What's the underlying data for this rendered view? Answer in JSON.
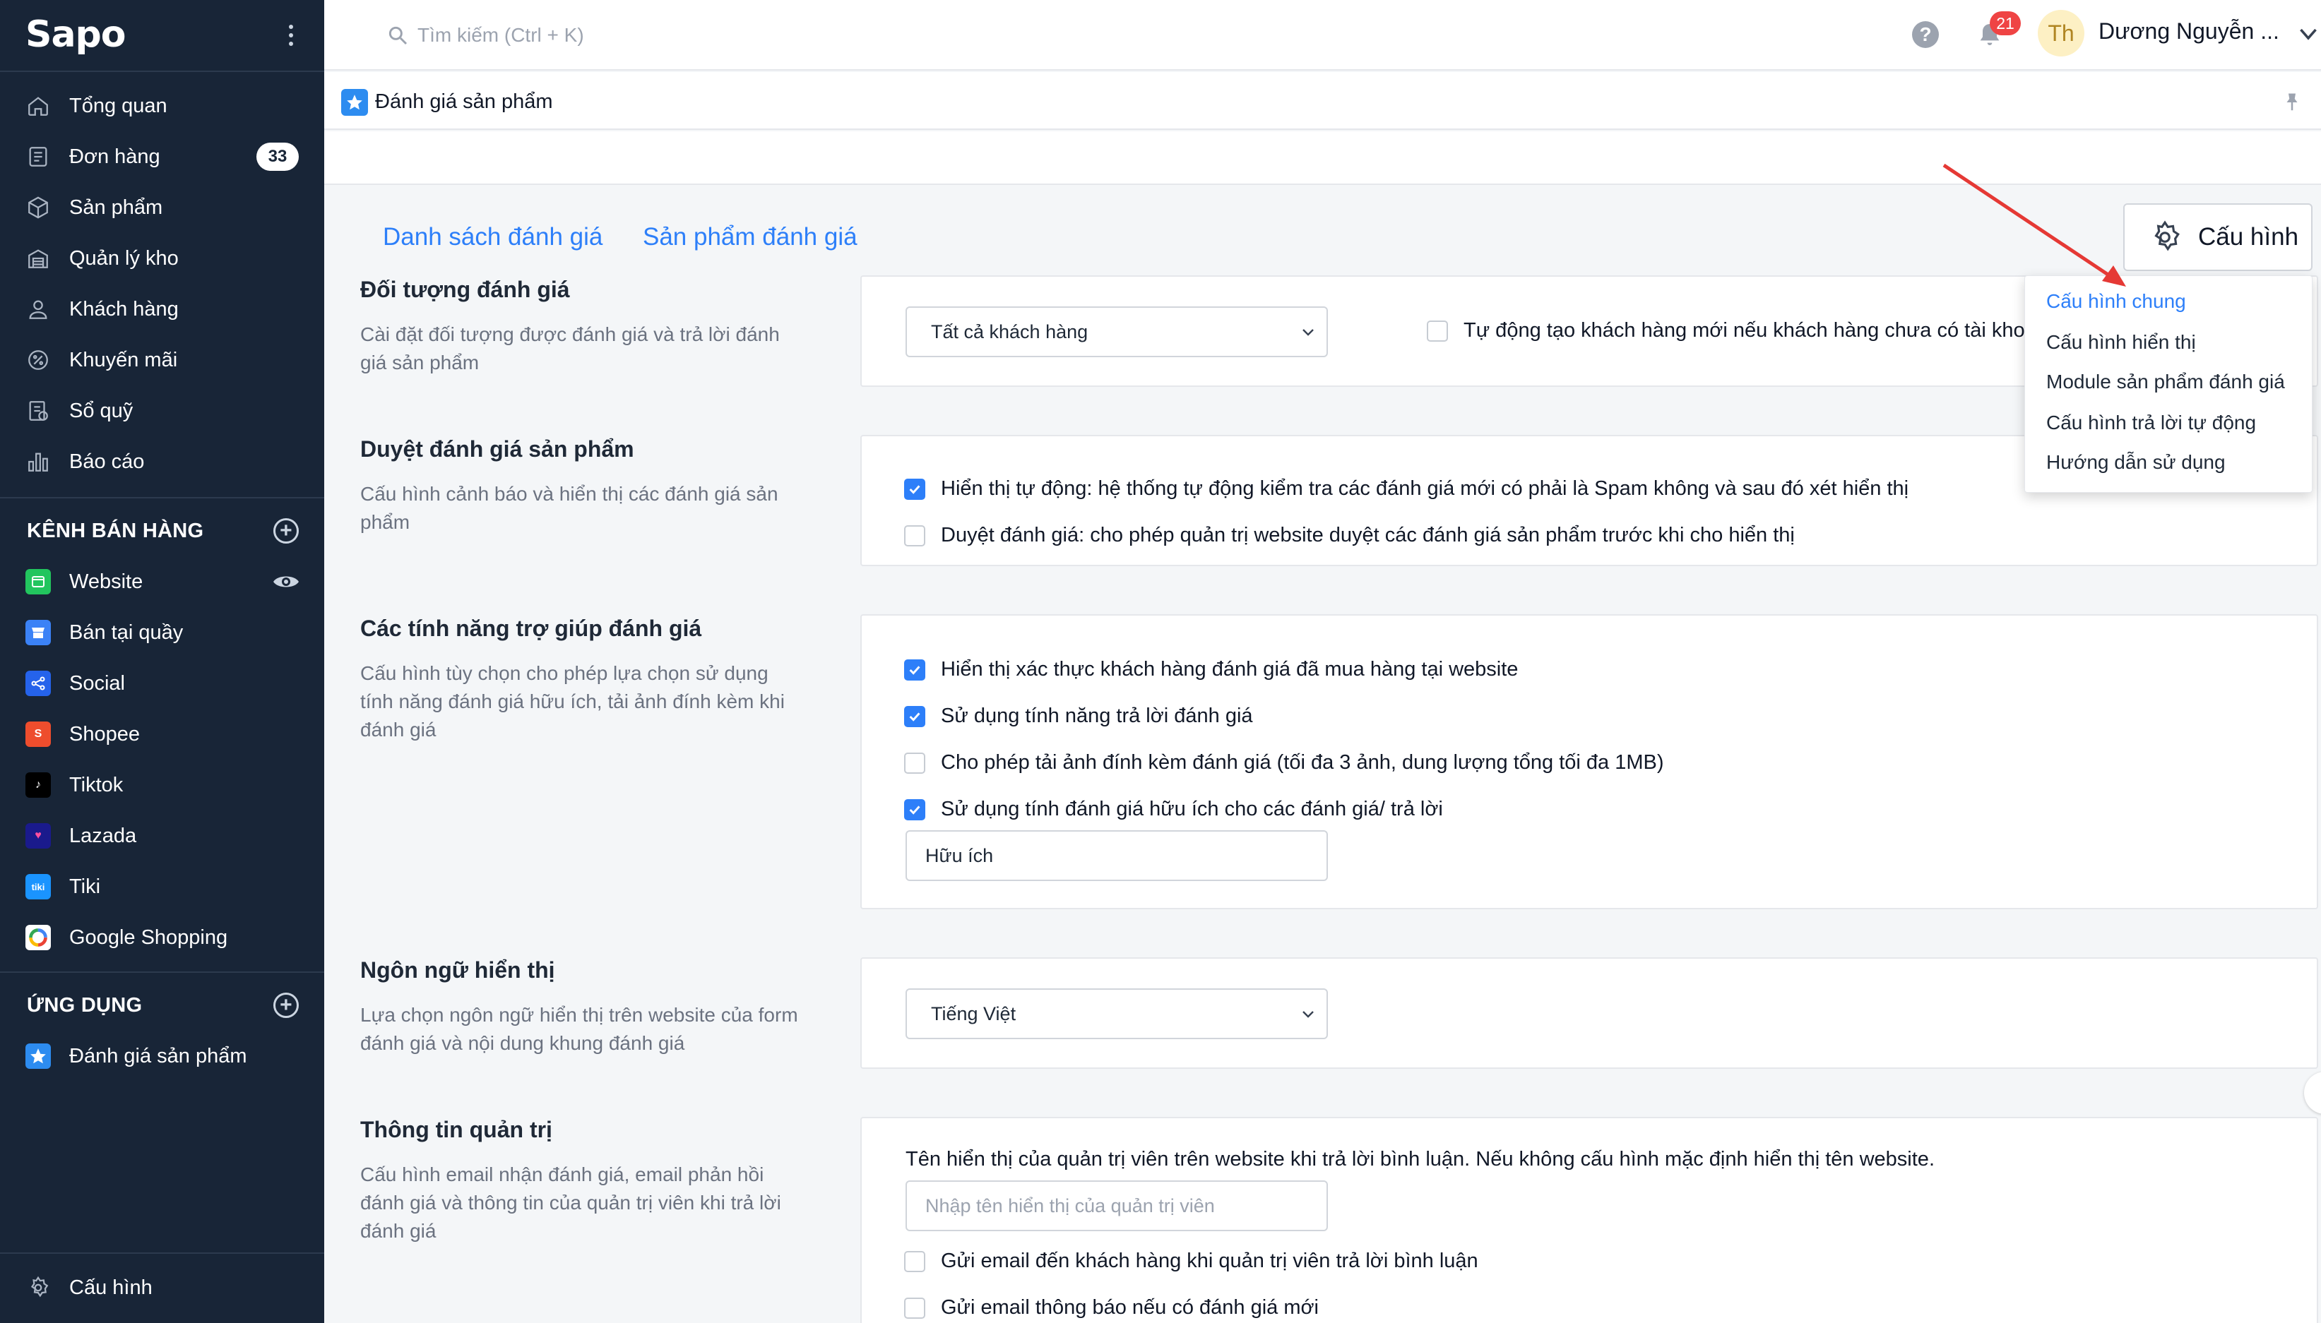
{
  "sidebar": {
    "logo": "Sapo",
    "nav": [
      {
        "label": "Tổng quan",
        "icon": "home-icon"
      },
      {
        "label": "Đơn hàng",
        "icon": "orders-icon",
        "badge": "33"
      },
      {
        "label": "Sản phẩm",
        "icon": "box-icon"
      },
      {
        "label": "Quản lý kho",
        "icon": "warehouse-icon"
      },
      {
        "label": "Khách hàng",
        "icon": "user-icon"
      },
      {
        "label": "Khuyến mãi",
        "icon": "discount-icon"
      },
      {
        "label": "Sổ quỹ",
        "icon": "cashbook-icon"
      },
      {
        "label": "Báo cáo",
        "icon": "report-icon"
      }
    ],
    "sales_channels_title": "KÊNH BÁN HÀNG",
    "channels": [
      {
        "label": "Website",
        "icon": "website-icon",
        "color": "#22c55e"
      },
      {
        "label": "Bán tại quầy",
        "icon": "pos-icon",
        "color": "#3b82f6"
      },
      {
        "label": "Social",
        "icon": "social-icon",
        "color": "#2563eb"
      },
      {
        "label": "Shopee",
        "icon": "shopee-icon",
        "color": "#ee4d2d"
      },
      {
        "label": "Tiktok",
        "icon": "tiktok-icon",
        "color": "#000000"
      },
      {
        "label": "Lazada",
        "icon": "lazada-icon",
        "color": "#1a1a8c"
      },
      {
        "label": "Tiki",
        "icon": "tiki-icon",
        "color": "#1a94ff"
      },
      {
        "label": "Google Shopping",
        "icon": "google-shopping-icon",
        "color": "#ffffff"
      }
    ],
    "apps_title": "ỨNG DỤNG",
    "apps": [
      {
        "label": "Đánh giá sản phẩm",
        "icon": "star-icon"
      }
    ],
    "settings_label": "Cấu hình"
  },
  "topbar": {
    "search_placeholder": "Tìm kiếm (Ctrl + K)",
    "notifications_count": "21",
    "avatar_initials": "Th",
    "user_name": "Dương Nguyễn ..."
  },
  "app_header": {
    "title": "Đánh giá sản phẩm"
  },
  "tabs": [
    {
      "label": "Danh sách đánh giá"
    },
    {
      "label": "Sản phẩm đánh giá"
    }
  ],
  "config_button": {
    "label": "Cấu hình"
  },
  "config_menu": [
    {
      "label": "Cấu hình chung",
      "active": true
    },
    {
      "label": "Cấu hình hiển thị"
    },
    {
      "label": "Module sản phẩm đánh giá"
    },
    {
      "label": "Cấu hình trả lời tự động"
    },
    {
      "label": "Hướng dẫn sử dụng"
    }
  ],
  "sections": {
    "target": {
      "title": "Đối tượng đánh giá",
      "desc": "Cài đặt đối tượng được đánh giá và trả lời đánh giá sản phẩm",
      "select_value": "Tất cả khách hàng",
      "auto_create_label": "Tự động tạo khách hàng mới nếu khách hàng chưa có tài khoả",
      "auto_create_checked": false
    },
    "moderation": {
      "title": "Duyệt đánh giá sản phẩm",
      "desc": "Cấu hình cảnh báo và hiển thị các đánh giá sản phẩm",
      "options": [
        {
          "label": "Hiển thị tự động: hệ thống tự động kiểm tra các đánh giá mới có phải là Spam không và sau đó xét hiển thị",
          "checked": true
        },
        {
          "label": "Duyệt đánh giá: cho phép quản trị website duyệt các đánh giá sản phẩm trước khi cho hiển thị",
          "checked": false
        }
      ]
    },
    "features": {
      "title": "Các tính năng trợ giúp đánh giá",
      "desc": "Cấu hình tùy chọn cho phép lựa chọn sử dụng tính năng đánh giá hữu ích, tải ảnh đính kèm khi đánh giá",
      "options": [
        {
          "label": "Hiển thị xác thực khách hàng đánh giá đã mua hàng tại website",
          "checked": true
        },
        {
          "label": "Sử dụng tính năng trả lời đánh giá",
          "checked": true
        },
        {
          "label": "Cho phép tải ảnh đính kèm đánh giá (tối đa 3 ảnh, dung lượng tổng tối đa 1MB)",
          "checked": false
        },
        {
          "label": "Sử dụng tính đánh giá hữu ích cho các đánh giá/ trả lời",
          "checked": true
        }
      ],
      "helpful_value": "Hữu ích"
    },
    "language": {
      "title": "Ngôn ngữ hiển thị",
      "desc": "Lựa chọn ngôn ngữ hiển thị trên website của form đánh giá và nội dung khung đánh giá",
      "select_value": "Tiếng Việt"
    },
    "admin": {
      "title": "Thông tin quản trị",
      "desc": "Cấu hình email nhận đánh giá, email phản hồi đánh giá và thông tin của quản trị viên khi trả lời đánh giá",
      "display_name_label": "Tên hiển thị của quản trị viên trên website khi trả lời bình luận. Nếu không cấu hình mặc định hiển thị tên website.",
      "display_name_placeholder": "Nhập tên hiển thị của quản trị viên",
      "options": [
        {
          "label": "Gửi email đến khách hàng khi quản trị viên trả lời bình luận",
          "checked": false
        },
        {
          "label": "Gửi email thông báo nếu có đánh giá mới",
          "checked": false
        }
      ]
    }
  },
  "colors": {
    "sidebar_bg": "#182537",
    "accent": "#2d7ff9",
    "annotation_arrow": "#e53935"
  }
}
